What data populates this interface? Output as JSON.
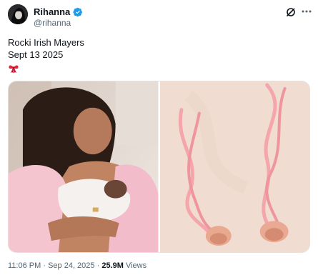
{
  "author": {
    "display_name": "Rihanna",
    "handle": "@rihanna",
    "verified": true
  },
  "icons": {
    "verified": "verified-badge-icon",
    "grok": "grok-icon",
    "more": "more-icon",
    "emoji": "ribbon-emoji"
  },
  "tweet": {
    "line1": "Rocki Irish Mayers",
    "line2": "Sept 13 2025",
    "emoji": "🎀"
  },
  "media": [
    {
      "kind": "photo",
      "name": "mother-and-baby-photo"
    },
    {
      "kind": "photo",
      "name": "pink-ribbon-baby-shoes-photo"
    }
  ],
  "meta": {
    "time": "11:06 PM",
    "separator": "·",
    "date": "Sep 24, 2025",
    "views_count": "25.9M",
    "views_label": "Views"
  },
  "colors": {
    "accent": "#1d9bf0",
    "secondary_text": "#536471",
    "primary_text": "#0f1419",
    "ribbon_pink": "#f4a6ac"
  }
}
